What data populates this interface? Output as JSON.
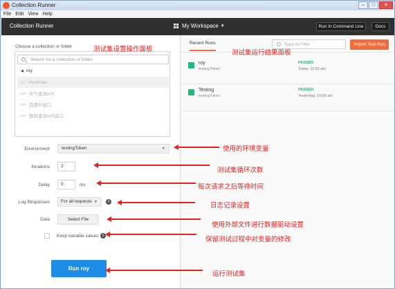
{
  "window": {
    "title": "Collection Runner",
    "controls": [
      "–",
      "□",
      "✕"
    ]
  },
  "menu": [
    "File",
    "Edit",
    "View",
    "Help"
  ],
  "header": {
    "app_title": "Collection Runner",
    "workspace": "My Workspace",
    "run_cmd_label": "Run In Command Line",
    "docs_label": "Docs"
  },
  "left": {
    "choose_label": "Choose a collection or folder",
    "search_placeholder": "Search for a collection or folder",
    "collection_name": "roy",
    "requests": [
      {
        "method": "GET",
        "name": "Postman"
      },
      {
        "method": "GET",
        "name": "天气查询API"
      },
      {
        "method": "GET",
        "name": "百度IP接口"
      },
      {
        "method": "GET",
        "name": "数码查询API接口"
      }
    ],
    "environment_label": "Environment",
    "environment_value": "testingToken",
    "iterations_label": "Iterations",
    "iterations_value": "2",
    "delay_label": "Delay",
    "delay_value": "0",
    "delay_unit": "ms",
    "log_label": "Log Responses",
    "log_value": "For all requests",
    "data_label": "Data",
    "select_file_label": "Select File",
    "keep_label": "Keep variable values",
    "run_label": "Run roy"
  },
  "right": {
    "tab_label": "Recent Runs",
    "filter_placeholder": "Type to Filter",
    "import_label": "Import Test Run",
    "runs": [
      {
        "name": "roy",
        "env": "testingToken",
        "status": "PASSED",
        "time": "Today, 11:59 am"
      },
      {
        "name": "Testing",
        "env": "testingToken",
        "status": "PASSED",
        "time": "Yesterday, 10:06 am"
      }
    ]
  },
  "annotations": {
    "settings_panel": "测试集设置操作面板",
    "results_panel": "测试集运行结果面板",
    "environment": "使用的环境变量",
    "iterations": "测试集循环次数",
    "delay": "每次请求之后等待时间",
    "log": "日志记录设置",
    "data": "使用外部文件进行数据驱动设置",
    "keep": "保留测试过程中对变量的修改",
    "run": "运行测试集"
  },
  "colors": {
    "accent": "#f26b3a",
    "run_button": "#1f8ce6",
    "passed": "#26b47f",
    "annotation": "#e8201c"
  }
}
